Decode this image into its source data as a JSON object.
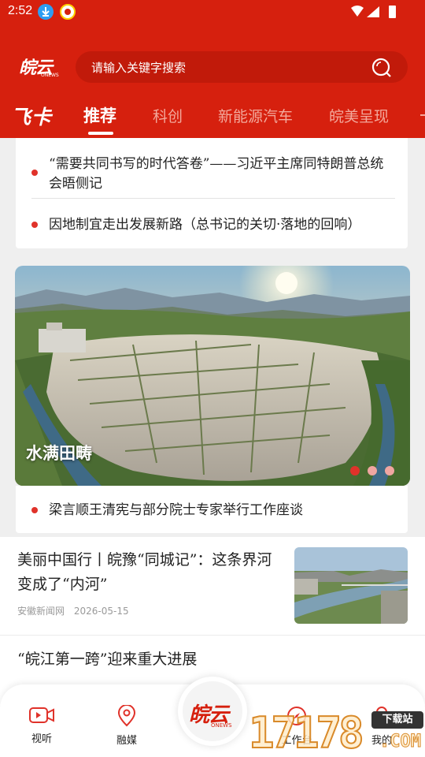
{
  "status_bar": {
    "time": "2:52"
  },
  "header": {
    "logo_text": "皖云",
    "logo_subtext": "ONEWS",
    "search_placeholder": "请输入关键字搜索"
  },
  "tabs": {
    "feika": "飞卡",
    "items": [
      "推荐",
      "科创",
      "新能源汽车",
      "皖美呈现"
    ],
    "active_index": 0
  },
  "top_headlines": [
    "“需要共同书写的时代答卷”——习近平主席同特朗普总统会晤侧记",
    "因地制宜走出发展新路（总书记的关切·落地的回响）"
  ],
  "banner": {
    "title": "水满田畴",
    "page_count": 3,
    "active_page": 1
  },
  "banner_news": "梁言顺王清宪与部分院士专家举行工作座谈",
  "articles": [
    {
      "title": "美丽中国行丨皖豫“同城记”：这条界河变成了“内河”",
      "source": "安徽新闻网",
      "date": "2026-05-15"
    },
    {
      "title": "“皖江第一跨”迎来重大进展"
    }
  ],
  "bottom_nav": {
    "items": [
      "视听",
      "融媒",
      "工作台",
      "我的"
    ],
    "center_logo": "皖云",
    "center_subtext": "ONEWS"
  },
  "watermark": {
    "digits": "17178",
    "badge": "下载站",
    "suffix": ".COM"
  },
  "colors": {
    "brand_red": "#d6200e",
    "bullet_red": "#e0322a",
    "active_dot": "#e0322a",
    "inactive_dot": "#f0a6a1"
  }
}
